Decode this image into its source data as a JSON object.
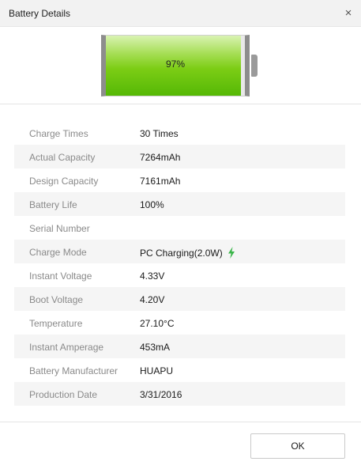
{
  "window": {
    "title": "Battery Details",
    "close_glyph": "×"
  },
  "battery": {
    "level_percent": 97,
    "label": "97%",
    "fill_color": "#7ccd15"
  },
  "details": [
    {
      "label": "Charge Times",
      "value": "30 Times"
    },
    {
      "label": "Actual Capacity",
      "value": "7264mAh"
    },
    {
      "label": "Design Capacity",
      "value": "7161mAh"
    },
    {
      "label": "Battery Life",
      "value": "100%"
    },
    {
      "label": "Serial Number",
      "value": ""
    },
    {
      "label": "Charge Mode",
      "value": "PC Charging(2.0W)",
      "icon": "lightning-bolt-icon"
    },
    {
      "label": "Instant Voltage",
      "value": "4.33V"
    },
    {
      "label": "Boot Voltage",
      "value": "4.20V"
    },
    {
      "label": "Temperature",
      "value": "27.10°C"
    },
    {
      "label": "Instant Amperage",
      "value": "453mA"
    },
    {
      "label": "Battery Manufacturer",
      "value": "HUAPU"
    },
    {
      "label": "Production Date",
      "value": "3/31/2016"
    }
  ],
  "footer": {
    "ok_label": "OK"
  }
}
